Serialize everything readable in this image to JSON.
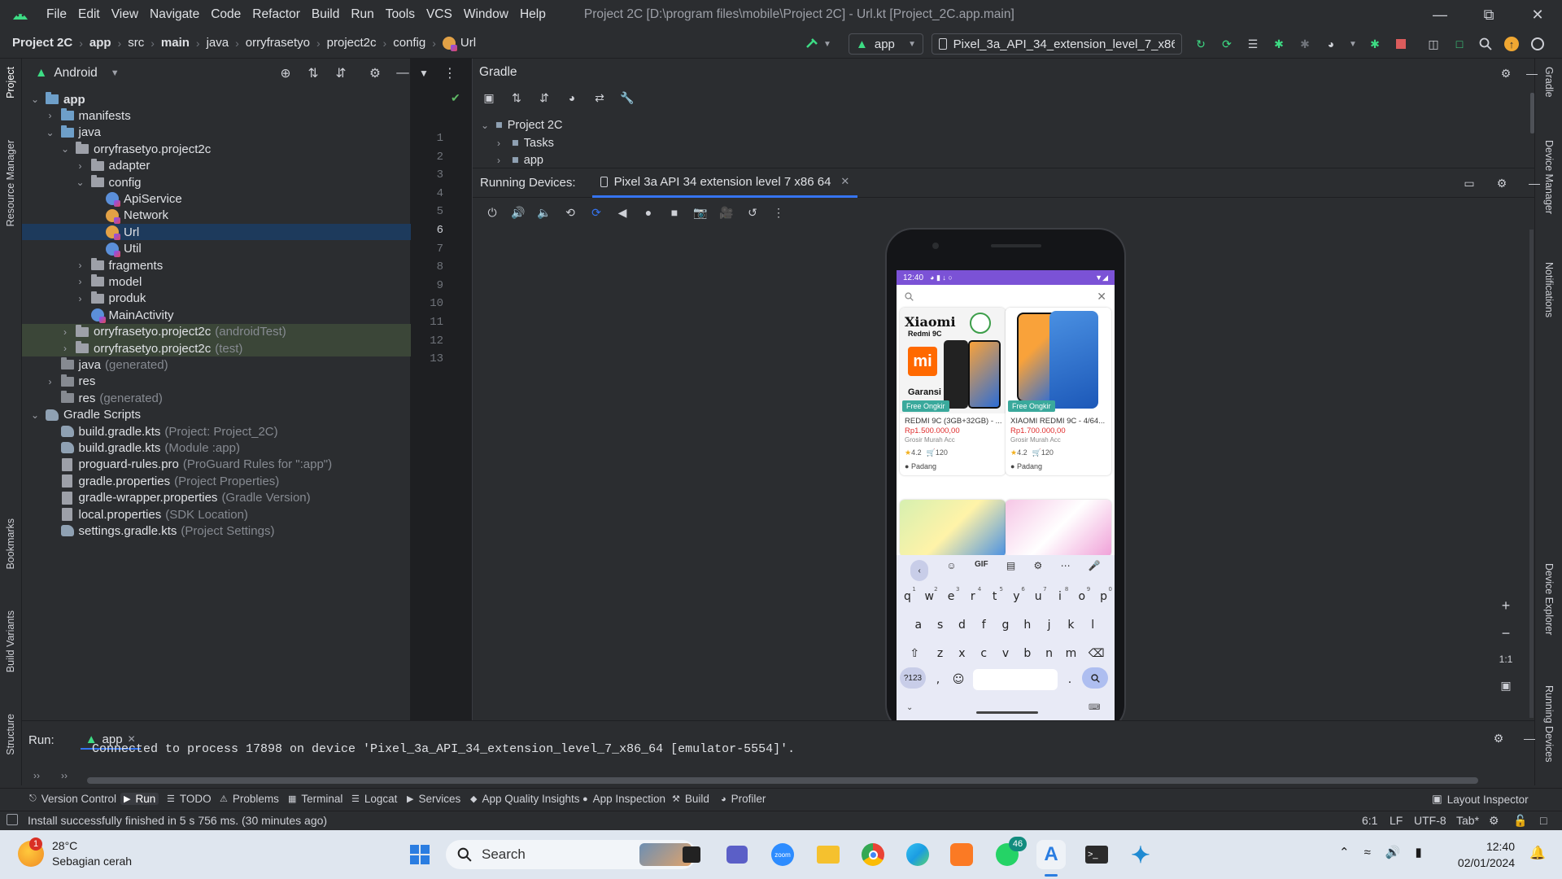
{
  "menu": [
    "File",
    "Edit",
    "View",
    "Navigate",
    "Code",
    "Refactor",
    "Build",
    "Run",
    "Tools",
    "VCS",
    "Window",
    "Help"
  ],
  "window_title": "Project 2C [D:\\program files\\mobile\\Project 2C] - Url.kt [Project_2C.app.main]",
  "breadcrumb": [
    "Project 2C",
    "app",
    "src",
    "main",
    "java",
    "orryfrasetyo",
    "project2c",
    "config",
    "Url"
  ],
  "run_config": "app",
  "device_selector": "Pixel_3a_API_34_extension_level_7_x86..",
  "project_panel": {
    "view_mode": "Android",
    "tree": [
      {
        "label": "app",
        "hint": "",
        "icon": "module",
        "depth": 0,
        "chev": "down"
      },
      {
        "label": "manifests",
        "hint": "",
        "icon": "folder",
        "depth": 1,
        "chev": "right"
      },
      {
        "label": "java",
        "hint": "",
        "icon": "folder",
        "depth": 1,
        "chev": "down"
      },
      {
        "label": "orryfrasetyo.project2c",
        "hint": "",
        "icon": "package",
        "depth": 2,
        "chev": "down"
      },
      {
        "label": "adapter",
        "hint": "",
        "icon": "package",
        "depth": 3,
        "chev": "right"
      },
      {
        "label": "config",
        "hint": "",
        "icon": "package",
        "depth": 3,
        "chev": "down"
      },
      {
        "label": "ApiService",
        "hint": "",
        "icon": "kt-blue",
        "depth": 4,
        "chev": ""
      },
      {
        "label": "Network",
        "hint": "",
        "icon": "kt-orange",
        "depth": 4,
        "chev": ""
      },
      {
        "label": "Url",
        "hint": "",
        "icon": "kt-orange",
        "depth": 4,
        "chev": "",
        "selected": true
      },
      {
        "label": "Util",
        "hint": "",
        "icon": "kt-blue",
        "depth": 4,
        "chev": ""
      },
      {
        "label": "fragments",
        "hint": "",
        "icon": "package",
        "depth": 3,
        "chev": "right"
      },
      {
        "label": "model",
        "hint": "",
        "icon": "package",
        "depth": 3,
        "chev": "right"
      },
      {
        "label": "produk",
        "hint": "",
        "icon": "package",
        "depth": 3,
        "chev": "right"
      },
      {
        "label": "MainActivity",
        "hint": "",
        "icon": "kt-blue",
        "depth": 3,
        "chev": ""
      },
      {
        "label": "orryfrasetyo.project2c",
        "hint": "(androidTest)",
        "icon": "package",
        "depth": 2,
        "chev": "right",
        "test": true
      },
      {
        "label": "orryfrasetyo.project2c",
        "hint": "(test)",
        "icon": "package",
        "depth": 2,
        "chev": "right",
        "test": true
      },
      {
        "label": "java",
        "hint": "(generated)",
        "icon": "folder-grey",
        "depth": 1,
        "chev": ""
      },
      {
        "label": "res",
        "hint": "",
        "icon": "folder-grey",
        "depth": 1,
        "chev": "right"
      },
      {
        "label": "res",
        "hint": "(generated)",
        "icon": "folder-grey",
        "depth": 1,
        "chev": ""
      },
      {
        "label": "Gradle Scripts",
        "hint": "",
        "icon": "gradle",
        "depth": 0,
        "chev": "down"
      },
      {
        "label": "build.gradle.kts",
        "hint": "(Project: Project_2C)",
        "icon": "gradle-file",
        "depth": 1,
        "chev": ""
      },
      {
        "label": "build.gradle.kts",
        "hint": "(Module :app)",
        "icon": "gradle-file",
        "depth": 1,
        "chev": ""
      },
      {
        "label": "proguard-rules.pro",
        "hint": "(ProGuard Rules for \":app\")",
        "icon": "file",
        "depth": 1,
        "chev": ""
      },
      {
        "label": "gradle.properties",
        "hint": "(Project Properties)",
        "icon": "file",
        "depth": 1,
        "chev": ""
      },
      {
        "label": "gradle-wrapper.properties",
        "hint": "(Gradle Version)",
        "icon": "file",
        "depth": 1,
        "chev": ""
      },
      {
        "label": "local.properties",
        "hint": "(SDK Location)",
        "icon": "file",
        "depth": 1,
        "chev": ""
      },
      {
        "label": "settings.gradle.kts",
        "hint": "(Project Settings)",
        "icon": "gradle-file",
        "depth": 1,
        "chev": ""
      }
    ]
  },
  "editor": {
    "line_numbers": [
      "1",
      "2",
      "3",
      "4",
      "5",
      "6",
      "7",
      "8",
      "9",
      "10",
      "11",
      "12",
      "13"
    ],
    "current_line": "6"
  },
  "gradle_panel": {
    "title": "Gradle",
    "tree": [
      "Project 2C",
      "Tasks",
      "app"
    ]
  },
  "running_devices": {
    "label": "Running Devices:",
    "tab": "Pixel 3a API 34 extension level 7 x86 64"
  },
  "phone": {
    "status_time": "12:40",
    "products": [
      {
        "name": "REDMI 9C (3GB+32GB) - ...",
        "price": "Rp1.500.000,00",
        "seller": "Grosir Murah Acc",
        "rating": "4.2",
        "sold": "120",
        "location": "Padang",
        "badge": "Free Ongkir",
        "brand": "Xiaomi",
        "model": "Redmi 9C",
        "promo": "Garansi"
      },
      {
        "name": "XIAOMI REDMI 9C - 4/64...",
        "price": "Rp1.700.000,00",
        "seller": "Grosir Murah Acc",
        "rating": "4.2",
        "sold": "120",
        "location": "Padang",
        "badge": "Free Ongkir",
        "brand": "",
        "model": "",
        "promo": ""
      }
    ],
    "keyboard": {
      "row1": [
        "q",
        "w",
        "e",
        "r",
        "t",
        "y",
        "u",
        "i",
        "o",
        "p"
      ],
      "row1_hints": [
        "1",
        "2",
        "3",
        "4",
        "5",
        "6",
        "7",
        "8",
        "9",
        "0"
      ],
      "row2": [
        "a",
        "s",
        "d",
        "f",
        "g",
        "h",
        "j",
        "k",
        "l"
      ],
      "row3": [
        "z",
        "x",
        "c",
        "v",
        "b",
        "n",
        "m"
      ],
      "sym_key": "?123",
      "comma": ",",
      "period": ".",
      "gif": "GIF"
    }
  },
  "emu_controls": {
    "plus": "+",
    "minus": "−",
    "ratio": "1:1"
  },
  "run_panel": {
    "label": "Run:",
    "config": "app",
    "output": "Connected to process 17898 on device 'Pixel_3a_API_34_extension_level_7_x86_64 [emulator-5554]'."
  },
  "bottom_tools": [
    "Version Control",
    "Run",
    "TODO",
    "Problems",
    "Terminal",
    "Logcat",
    "Services",
    "App Quality Insights",
    "App Inspection",
    "Build",
    "Profiler"
  ],
  "layout_inspector": "Layout Inspector",
  "status": {
    "message": "Install successfully finished in 5 s 756 ms. (30 minutes ago)",
    "position": "6:1",
    "line_sep": "LF",
    "encoding": "UTF-8",
    "indent": "Tab*"
  },
  "side_labels_left": [
    "Project",
    "Resource Manager",
    "Bookmarks",
    "Build Variants",
    "Structure"
  ],
  "side_labels_right": [
    "Gradle",
    "Device Manager",
    "Notifications",
    "Device Explorer",
    "Running Devices"
  ],
  "taskbar": {
    "weather_temp": "28°C",
    "weather_desc": "Sebagian cerah",
    "weather_badge": "1",
    "search": "Search",
    "whatsapp_badge": "46",
    "time": "12:40",
    "date": "02/01/2024"
  },
  "colors": {
    "accent": "#3574f0",
    "android_green": "#3ddc84",
    "selection": "#1d3a5c",
    "price_red": "#e02d2d"
  }
}
